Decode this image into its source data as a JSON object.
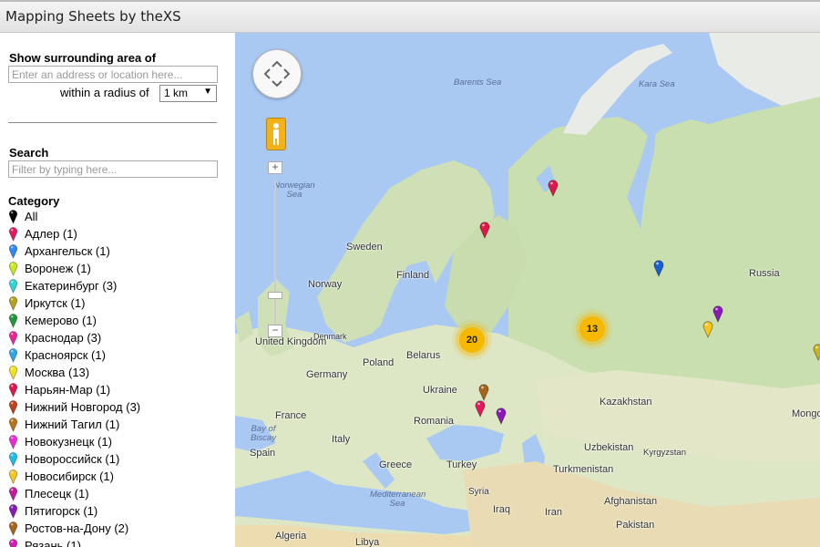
{
  "app": {
    "title": "Mapping Sheets by theXS"
  },
  "surround": {
    "label": "Show surrounding area of",
    "placeholder": "Enter an address or location here...",
    "radius_label": "within a radius of",
    "radius_value": "1 km"
  },
  "search": {
    "label": "Search",
    "placeholder": "Filter by typing here..."
  },
  "category": {
    "label": "Category",
    "items": [
      {
        "label": "All",
        "color": "#000000"
      },
      {
        "label": "Адлер (1)",
        "color": "#e8175d"
      },
      {
        "label": "Архангельск (1)",
        "color": "#2a8af7"
      },
      {
        "label": "Воронеж (1)",
        "color": "#c9e81a"
      },
      {
        "label": "Екатеринбург (3)",
        "color": "#2ad7d7"
      },
      {
        "label": "Иркутск (1)",
        "color": "#b8a21a"
      },
      {
        "label": "Кемерово (1)",
        "color": "#1f9a3a"
      },
      {
        "label": "Краснодар (3)",
        "color": "#f0229a"
      },
      {
        "label": "Красноярск (1)",
        "color": "#29a7e8"
      },
      {
        "label": "Москва (13)",
        "color": "#f4e31a"
      },
      {
        "label": "Нарьян-Мар (1)",
        "color": "#e0174a"
      },
      {
        "label": "Нижний Новгород (3)",
        "color": "#c0421a"
      },
      {
        "label": "Нижний Тагил (1)",
        "color": "#b8741a"
      },
      {
        "label": "Новокузнецк (1)",
        "color": "#f02ad7"
      },
      {
        "label": "Новороссийск (1)",
        "color": "#1ac0e8"
      },
      {
        "label": "Новосибирск (1)",
        "color": "#f7c61a"
      },
      {
        "label": "Плесецк (1)",
        "color": "#c71a9a"
      },
      {
        "label": "Пятигорск (1)",
        "color": "#8a1ab8"
      },
      {
        "label": "Ростов-на-Дону (2)",
        "color": "#a8651a"
      },
      {
        "label": "Рязань (1)",
        "color": "#d41ab8"
      }
    ]
  },
  "map": {
    "countries": [
      "Sweden",
      "Norway",
      "Finland",
      "Denmark",
      "United Kingdom",
      "Poland",
      "Belarus",
      "Germany",
      "Ukraine",
      "France",
      "Romania",
      "Italy",
      "Spain",
      "Greece",
      "Turkey",
      "Syria",
      "Iraq",
      "Iran",
      "Algeria",
      "Libya",
      "Kazakhstan",
      "Uzbekistan",
      "Kyrgyzstan",
      "Turkmenistan",
      "Afghanistan",
      "Pakistan",
      "Russia",
      "Mongo"
    ],
    "seas": [
      "Barents Sea",
      "Kara Sea",
      "Norwegian Sea",
      "Bay of Biscay",
      "Mediterranean Sea"
    ],
    "clusters": [
      "20",
      "13"
    ],
    "markers": [
      {
        "color": "#e0174a"
      },
      {
        "color": "#e0174a"
      },
      {
        "color": "#1a5fd0"
      },
      {
        "color": "#8a1ab8"
      },
      {
        "color": "#f7c61a"
      },
      {
        "color": "#c7b21a"
      },
      {
        "color": "#a8651a"
      },
      {
        "color": "#e8175d"
      },
      {
        "color": "#8a1ab8"
      }
    ],
    "zoom_in": "+",
    "zoom_out": "−"
  }
}
